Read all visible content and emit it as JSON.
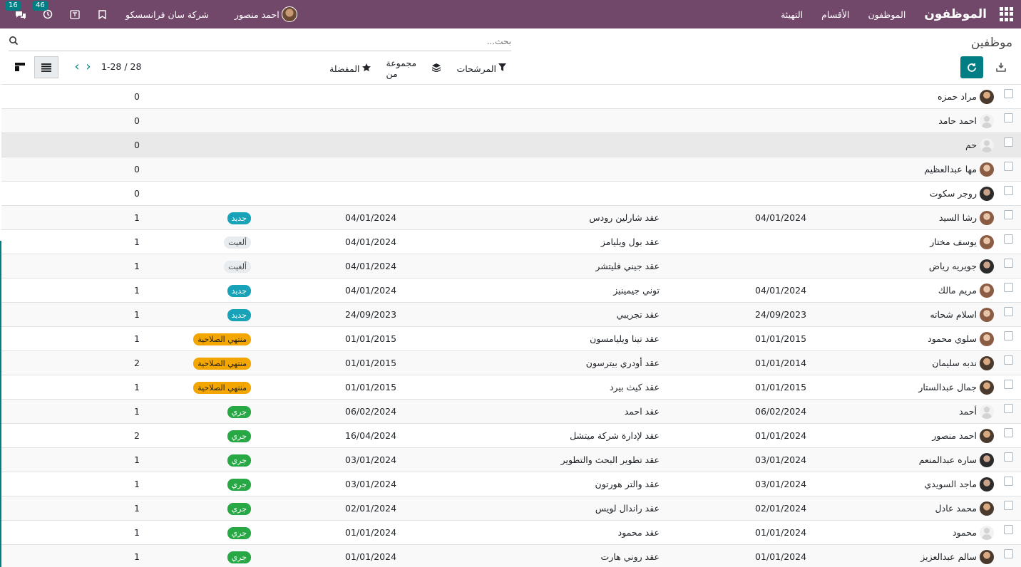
{
  "navbar": {
    "app_name": "الموظفون",
    "menus": [
      "الموظفون",
      "الأقسام",
      "التهيئة"
    ],
    "user_name": "احمد منصور",
    "company": "شركة سان فرانسسكو",
    "activity_count": "46",
    "messages_count": "16"
  },
  "control": {
    "title": "موظفين",
    "search_placeholder": "بحث...",
    "filters_label": "المرشحات",
    "groupby_label": "مجموعة من",
    "favorites_label": "المفضلة",
    "pager": "1-28 / 28"
  },
  "rows": [
    {
      "name": "مراد حمزه",
      "av": "photo",
      "date1": "",
      "contract": "",
      "date2": "",
      "status": "",
      "status_type": "",
      "count": "0"
    },
    {
      "name": "احمد حامد",
      "av": "blank",
      "date1": "",
      "contract": "",
      "date2": "",
      "status": "",
      "status_type": "",
      "count": "0"
    },
    {
      "name": "حم",
      "av": "blank",
      "date1": "",
      "contract": "",
      "date2": "",
      "status": "",
      "status_type": "",
      "count": "0"
    },
    {
      "name": "مها عبدالعظيم",
      "av": "photo2",
      "date1": "",
      "contract": "",
      "date2": "",
      "status": "",
      "status_type": "",
      "count": "0"
    },
    {
      "name": "روجر سكوت",
      "av": "photo3",
      "date1": "",
      "contract": "",
      "date2": "",
      "status": "",
      "status_type": "",
      "count": "0"
    },
    {
      "name": "رشا السيد",
      "av": "photo2",
      "date1": "04/01/2024",
      "contract": "عقد شارلين رودس",
      "date2": "04/01/2024",
      "status": "جديد",
      "status_type": "new",
      "count": "1"
    },
    {
      "name": "يوسف مختار",
      "av": "photo2",
      "date1": "",
      "contract": "عقد بول ويليامز",
      "date2": "04/01/2024",
      "status": "ألغيت",
      "status_type": "cancel",
      "count": "1"
    },
    {
      "name": "جويريه رياض",
      "av": "photo3",
      "date1": "",
      "contract": "عقد جيني فليتشر",
      "date2": "04/01/2024",
      "status": "ألغيت",
      "status_type": "cancel",
      "count": "1"
    },
    {
      "name": "مريم مالك",
      "av": "photo2",
      "date1": "04/01/2024",
      "contract": "توني جيمينيز",
      "date2": "04/01/2024",
      "status": "جديد",
      "status_type": "new",
      "count": "1"
    },
    {
      "name": "اسلام شحاته",
      "av": "photo2",
      "date1": "24/09/2023",
      "contract": "عقد تجريبي",
      "date2": "24/09/2023",
      "status": "جديد",
      "status_type": "new",
      "count": "1"
    },
    {
      "name": "سلوي محمود",
      "av": "photo2",
      "date1": "01/01/2015",
      "contract": "عقد تينا ويليامسون",
      "date2": "01/01/2015",
      "status": "منتهي الصلاحية",
      "status_type": "expired",
      "count": "1"
    },
    {
      "name": "ندبه سليمان",
      "av": "photo",
      "date1": "01/01/2014",
      "contract": "عقد أودري بيترسون",
      "date2": "01/01/2015",
      "status": "منتهي الصلاحية",
      "status_type": "expired",
      "count": "2"
    },
    {
      "name": "جمال عبدالستار",
      "av": "photo",
      "date1": "01/01/2015",
      "contract": "عقد كيث بيرد",
      "date2": "01/01/2015",
      "status": "منتهي الصلاحية",
      "status_type": "expired",
      "count": "1"
    },
    {
      "name": "أحمد",
      "av": "blank",
      "date1": "06/02/2024",
      "contract": "عقد احمد",
      "date2": "06/02/2024",
      "status": "جري",
      "status_type": "running",
      "count": "1"
    },
    {
      "name": "احمد منصور",
      "av": "photo",
      "date1": "01/01/2024",
      "contract": "عقد لإدارة شركة ميتشل",
      "date2": "16/04/2024",
      "status": "جري",
      "status_type": "running",
      "count": "2"
    },
    {
      "name": "ساره عبدالمنعم",
      "av": "photo3",
      "date1": "03/01/2024",
      "contract": "عقد تطوير البحث والتطوير",
      "date2": "03/01/2024",
      "status": "جري",
      "status_type": "running",
      "count": "1"
    },
    {
      "name": "ماجد السويدي",
      "av": "photo3",
      "date1": "03/01/2024",
      "contract": "عقد والتر هورتون",
      "date2": "03/01/2024",
      "status": "جري",
      "status_type": "running",
      "count": "1"
    },
    {
      "name": "محمد عادل",
      "av": "photo",
      "date1": "02/01/2024",
      "contract": "عقد راندال لويس",
      "date2": "02/01/2024",
      "status": "جري",
      "status_type": "running",
      "count": "1"
    },
    {
      "name": "محمود",
      "av": "blank",
      "date1": "01/01/2024",
      "contract": "عقد محمود",
      "date2": "01/01/2024",
      "status": "جري",
      "status_type": "running",
      "count": "1"
    },
    {
      "name": "سالم عبدالعزيز",
      "av": "photo",
      "date1": "01/01/2024",
      "contract": "عقد روني هارت",
      "date2": "01/01/2024",
      "status": "جري",
      "status_type": "running",
      "count": "1"
    }
  ]
}
